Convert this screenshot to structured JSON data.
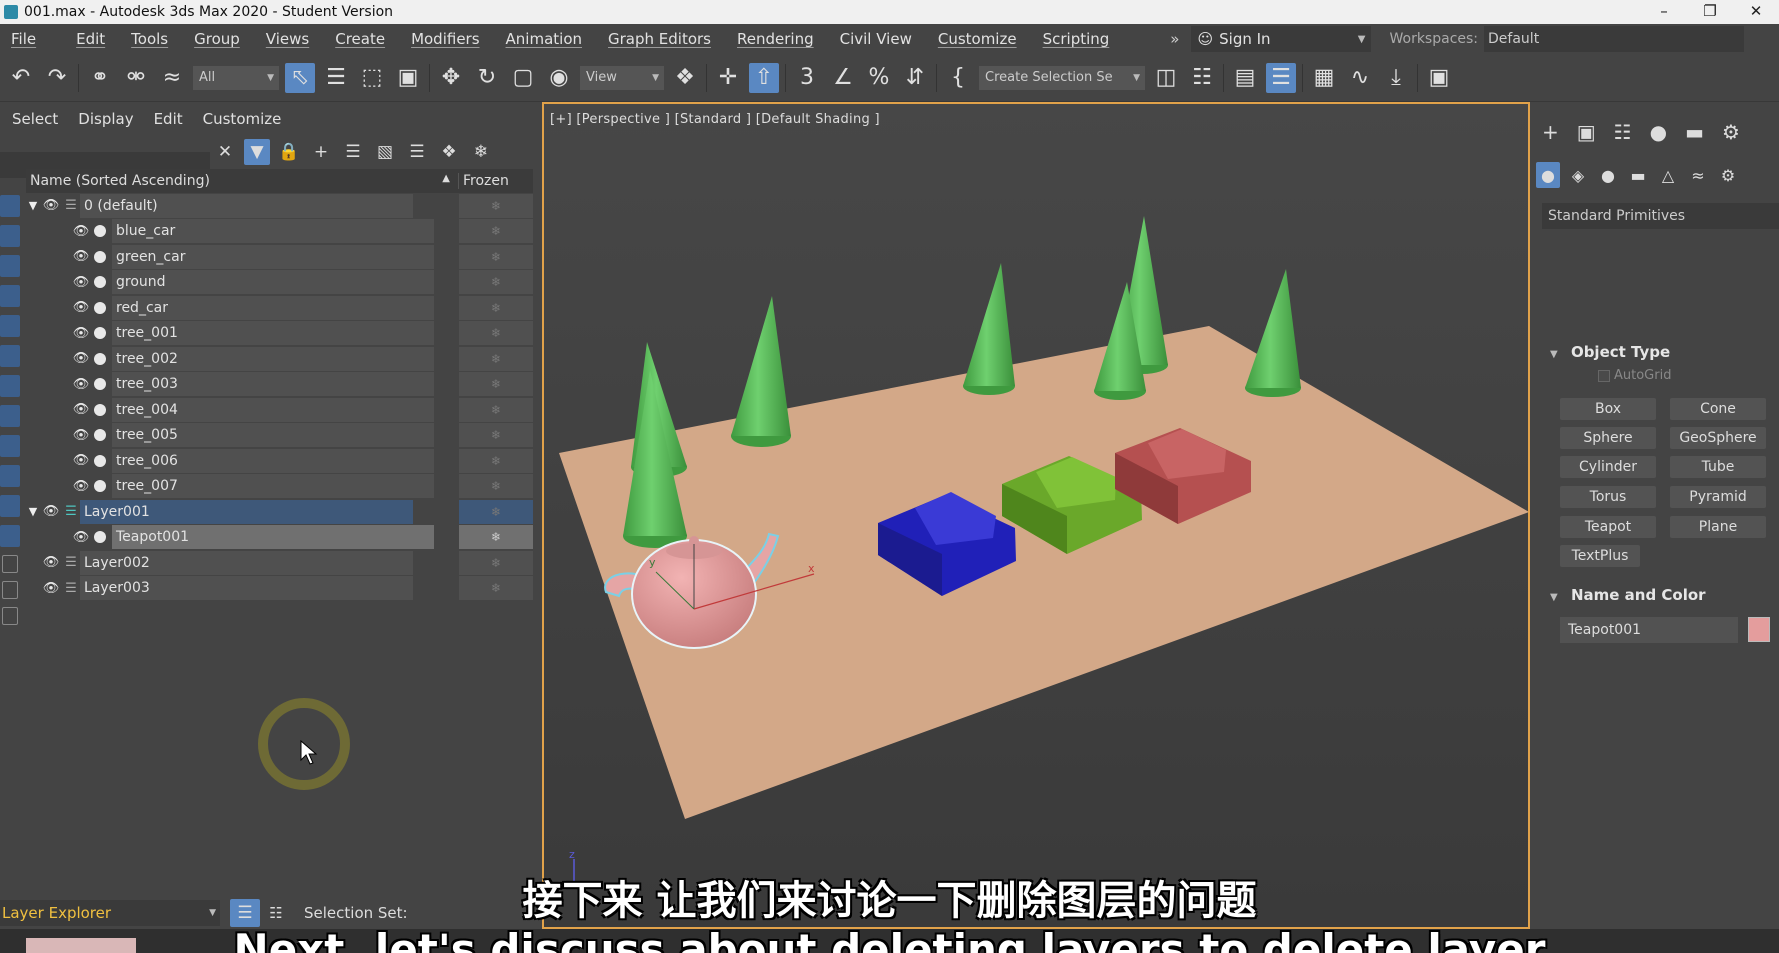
{
  "window": {
    "title": "001.max - Autodesk 3ds Max 2020 - Student Version",
    "min_icon": "minimize-icon",
    "max_symbol": "❐",
    "close_symbol": "✕"
  },
  "menu": {
    "items": [
      "File",
      "Edit",
      "Tools",
      "Group",
      "Views",
      "Create",
      "Modifiers",
      "Animation",
      "Graph Editors",
      "Rendering",
      "Civil View",
      "Customize",
      "Scripting"
    ],
    "more": "»",
    "sign_in": "Sign In",
    "workspaces_label": "Workspaces:",
    "workspaces_value": "Default"
  },
  "toolbar": {
    "selection_filter": "All",
    "ref_coord": "View",
    "named_selection": "Create Selection Se"
  },
  "scene_explorer": {
    "menu": [
      "Select",
      "Display",
      "Edit",
      "Customize"
    ],
    "header_name": "Name (Sorted Ascending)",
    "header_frozen": "Frozen",
    "sort_arrow": "▲",
    "frozen_symbol": "❄",
    "rows": [
      {
        "label": "0 (default)"
      },
      {
        "label": "blue_car"
      },
      {
        "label": "green_car"
      },
      {
        "label": "ground"
      },
      {
        "label": "red_car"
      },
      {
        "label": "tree_001"
      },
      {
        "label": "tree_002"
      },
      {
        "label": "tree_003"
      },
      {
        "label": "tree_004"
      },
      {
        "label": "tree_005"
      },
      {
        "label": "tree_006"
      },
      {
        "label": "tree_007"
      },
      {
        "label": "Layer001"
      },
      {
        "label": "Teapot001"
      },
      {
        "label": "Layer002"
      },
      {
        "label": "Layer003"
      }
    ]
  },
  "layer_explorer": {
    "label": "Layer Explorer",
    "selection_set_label": "Selection Set:"
  },
  "viewport": {
    "label": "[+] [Perspective ] [Standard ] [Default Shading ]",
    "axis_x": "x",
    "axis_y": "y",
    "axis_z": "z"
  },
  "command_panel": {
    "category": "Standard Primitives",
    "object_type_title": "Object Type",
    "autogrid": "AutoGrid",
    "buttons": [
      "Box",
      "Cone",
      "Sphere",
      "GeoSphere",
      "Cylinder",
      "Tube",
      "Torus",
      "Pyramid",
      "Teapot",
      "Plane",
      "TextPlus"
    ],
    "name_color_title": "Name and Color",
    "object_name": "Teapot001",
    "object_color": "#e49d9d"
  },
  "subtitles": {
    "chinese": "接下来 让我们来讨论一下删除图层的问题",
    "english": "Next, let's discuss about deleting layers to delete layer"
  }
}
